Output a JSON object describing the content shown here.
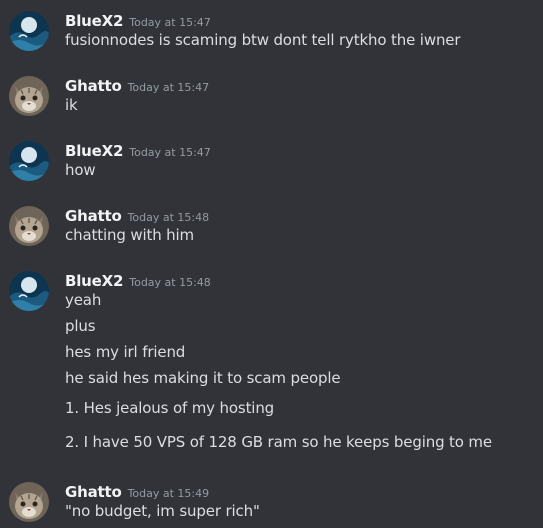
{
  "messages": [
    {
      "author": "BlueX2",
      "avatar_icon": "moon-wave-avatar-icon",
      "timestamp": "Today at 15:47",
      "lines": [
        "fusionnodes is scaming btw dont tell rytkho the iwner"
      ]
    },
    {
      "author": "Ghatto",
      "avatar_icon": "cat-avatar-icon",
      "timestamp": "Today at 15:47",
      "lines": [
        "ik"
      ]
    },
    {
      "author": "BlueX2",
      "avatar_icon": "moon-wave-avatar-icon",
      "timestamp": "Today at 15:47",
      "lines": [
        "how"
      ]
    },
    {
      "author": "Ghatto",
      "avatar_icon": "cat-avatar-icon",
      "timestamp": "Today at 15:48",
      "lines": [
        "chatting with him"
      ]
    },
    {
      "author": "BlueX2",
      "avatar_icon": "moon-wave-avatar-icon",
      "timestamp": "Today at 15:48",
      "lines": [
        "yeah",
        "plus",
        "hes my irl friend",
        "he said hes making it to scam people",
        "1. Hes jealous of my hosting",
        "2. I have 50 VPS of 128 GB ram so he keeps beging to me"
      ]
    },
    {
      "author": "Ghatto",
      "avatar_icon": "cat-avatar-icon",
      "timestamp": "Today at 15:49",
      "lines": [
        "\"no budget, im super rich\""
      ]
    }
  ]
}
